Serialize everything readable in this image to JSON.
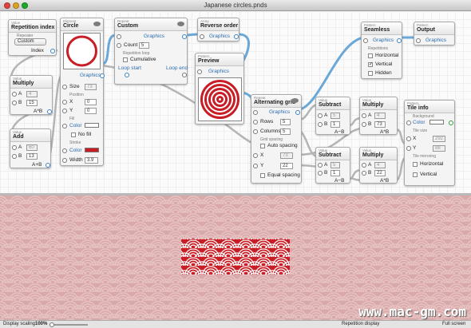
{
  "window": {
    "title": "Japanese circles.pnds"
  },
  "colors": {
    "wire": "#6aa8d8",
    "wire_gray": "#b4b4b4",
    "pattern_red": "#c81d25",
    "pattern_light": "#e8c0c0"
  },
  "nodes": {
    "repetition_index": {
      "category": "Value",
      "name": "Repetition index",
      "repeater_label": "Repeater",
      "repeater_value": "Custom",
      "index_label": "Index"
    },
    "multiply1": {
      "category": "Value",
      "name": "Multiply",
      "a_label": "A",
      "a_value": "4",
      "b_label": "B",
      "b_value": "15",
      "out_label": "A*B"
    },
    "add": {
      "category": "Value",
      "name": "Add",
      "a_label": "A",
      "a_value": "60",
      "b_label": "B",
      "b_value": "13",
      "out_label": "A+B"
    },
    "circle": {
      "category": "Element",
      "name": "Circle",
      "output_label": "Graphics",
      "size_label": "Size",
      "size_value": "73",
      "position_label": "Position",
      "x_label": "X",
      "x_value": "0",
      "y_label": "Y",
      "y_value": "0",
      "fill_label": "Fill",
      "fill_color_label": "Color",
      "no_fill_label": "No fill",
      "stroke_label": "Stroke",
      "stroke_color_label": "Color",
      "width_label": "Width",
      "width_value": "3.9"
    },
    "custom": {
      "category": "Repeat",
      "name": "Custom",
      "graphics_label": "Graphics",
      "count_label": "Count",
      "count_value": "5",
      "loop_label": "Repetition loop",
      "cumulative_label": "Cumulative",
      "loop_start_label": "Loop start",
      "loop_end_label": "Loop end"
    },
    "reverse_order": {
      "category": "Array",
      "name": "Reverse order",
      "graphics_label": "Graphics"
    },
    "preview": {
      "category": "Pattern",
      "name": "Preview",
      "graphics_label": "Graphics"
    },
    "alternating_grid": {
      "category": "Repeat",
      "name": "Alternating grid",
      "graphics_label": "Graphics",
      "rows_label": "Rows",
      "rows_value": "5",
      "columns_label": "Columns",
      "columns_value": "5",
      "spacing_label": "Grid spacing",
      "auto_spacing_label": "Auto spacing",
      "x_label": "X",
      "x_value": "73",
      "y_label": "Y",
      "y_value": "22",
      "equal_spacing_label": "Equal spacing"
    },
    "subtract1": {
      "category": "Value",
      "name": "Subtract",
      "a_label": "A",
      "a_value": "5",
      "b_label": "B",
      "b_value": "1",
      "out_label": "A−B"
    },
    "multiply2": {
      "category": "Value",
      "name": "Multiply",
      "a_label": "A",
      "a_value": "4",
      "b_label": "B",
      "b_value": "73",
      "out_label": "A*B"
    },
    "subtract2": {
      "category": "Value",
      "name": "Subtract",
      "a_label": "A",
      "a_value": "5",
      "b_label": "B",
      "b_value": "1",
      "out_label": "A−B"
    },
    "multiply3": {
      "category": "Value",
      "name": "Multiply",
      "a_label": "A",
      "a_value": "4",
      "b_label": "B",
      "b_value": "22",
      "out_label": "A*B"
    },
    "seamless": {
      "category": "Pattern",
      "name": "Seamless",
      "graphics_label": "Graphics",
      "repetitions_label": "Repetitions",
      "horizontal_label": "Horizontal",
      "vertical_label": "Vertical",
      "hidden_label": "Hidden"
    },
    "output": {
      "category": "Pattern",
      "name": "Output",
      "graphics_label": "Graphics"
    },
    "tile_info": {
      "category": "Pattern",
      "name": "Tile info",
      "background_label": "Background",
      "color_label": "Color",
      "tile_size_label": "Tile size",
      "x_label": "X",
      "x_value": "292",
      "y_label": "Y",
      "y_value": "88",
      "mirroring_label": "Tile mirroring",
      "horizontal_label": "Horizontal",
      "vertical_label": "Vertical"
    }
  },
  "status": {
    "scaling_label": "Display scaling",
    "scaling_value": "100%",
    "repetition_label": "Repetition display",
    "fullscreen_label": "Full screen"
  },
  "watermark": "www.mac-gm.com"
}
